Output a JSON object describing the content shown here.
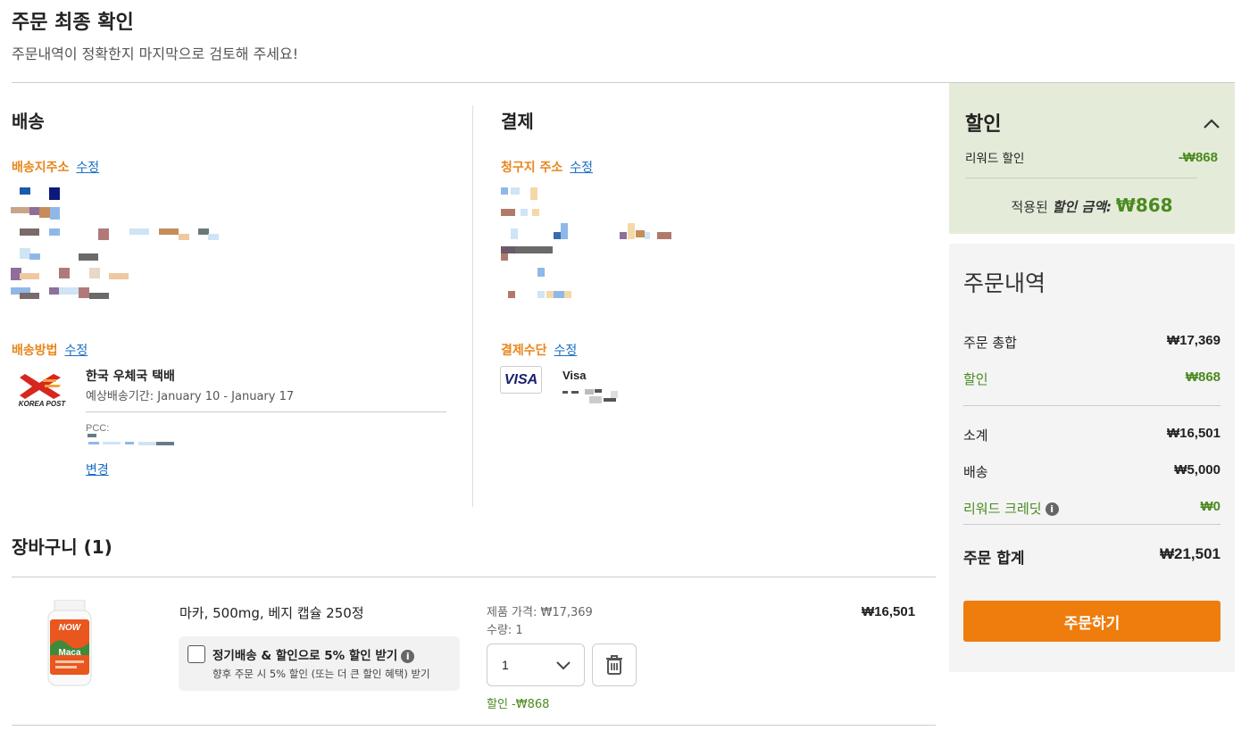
{
  "header": {
    "title": "주문 최종 확인",
    "subtitle": "주문내역이 정확한지 마지막으로 검토해 주세요!"
  },
  "shipping": {
    "heading": "배송",
    "address_label": "배송지주소",
    "edit_label": "수정",
    "method_label": "배송방법",
    "carrier_logo_text": "KOREA POST",
    "carrier_name": "한국 우체국 택배",
    "eta": "예상배송기간: January 10 - January 17",
    "pcc_label": "PCC:",
    "change_label": "변경"
  },
  "payment": {
    "heading": "결제",
    "billing_label": "청구지 주소",
    "edit_label": "수정",
    "method_label": "결제수단",
    "card_brand": "VISA",
    "card_name": "Visa"
  },
  "cart": {
    "heading": "장바구니 (1)",
    "item": {
      "name": "마카, 500mg, 베지 캡슐 250정",
      "autoship_label": "정기배송 & 할인으로 5% 할인 받기",
      "autoship_sub": "향후 주문 시 5% 할인 (또는 더 큰 할인 혜택) 받기",
      "unit_price": "제품 가격: ₩17,369",
      "qty_label": "수량: 1",
      "qty_value": "1",
      "discount": "할인 -₩868",
      "line_total": "₩16,501",
      "image_brand": "NOW",
      "image_product": "Maca"
    }
  },
  "discount_panel": {
    "title": "할인",
    "reward_label": "리워드 할인",
    "reward_value": "-₩868",
    "applied_prefix": "적용된",
    "applied_em": "할인 금액:",
    "applied_amount": "₩868"
  },
  "summary": {
    "title": "주문내역",
    "order_total_label": "주문 총합",
    "order_total_value": "₩17,369",
    "discount_label": "할인",
    "discount_value": "₩868",
    "subtotal_label": "소계",
    "subtotal_value": "₩16,501",
    "shipping_label": "배송",
    "shipping_value": "₩5,000",
    "reward_credit_label": "리워드 크레딧",
    "reward_credit_value": "₩0",
    "grand_total_label": "주문 합계",
    "grand_total_value": "₩21,501",
    "checkout_label": "주문하기"
  },
  "colors": {
    "accent_orange": "#ee7d0d",
    "label_orange": "#e8861b",
    "link_blue": "#1a6fc4",
    "green": "#4b8a1f",
    "discount_bg": "#e4ecd9"
  }
}
